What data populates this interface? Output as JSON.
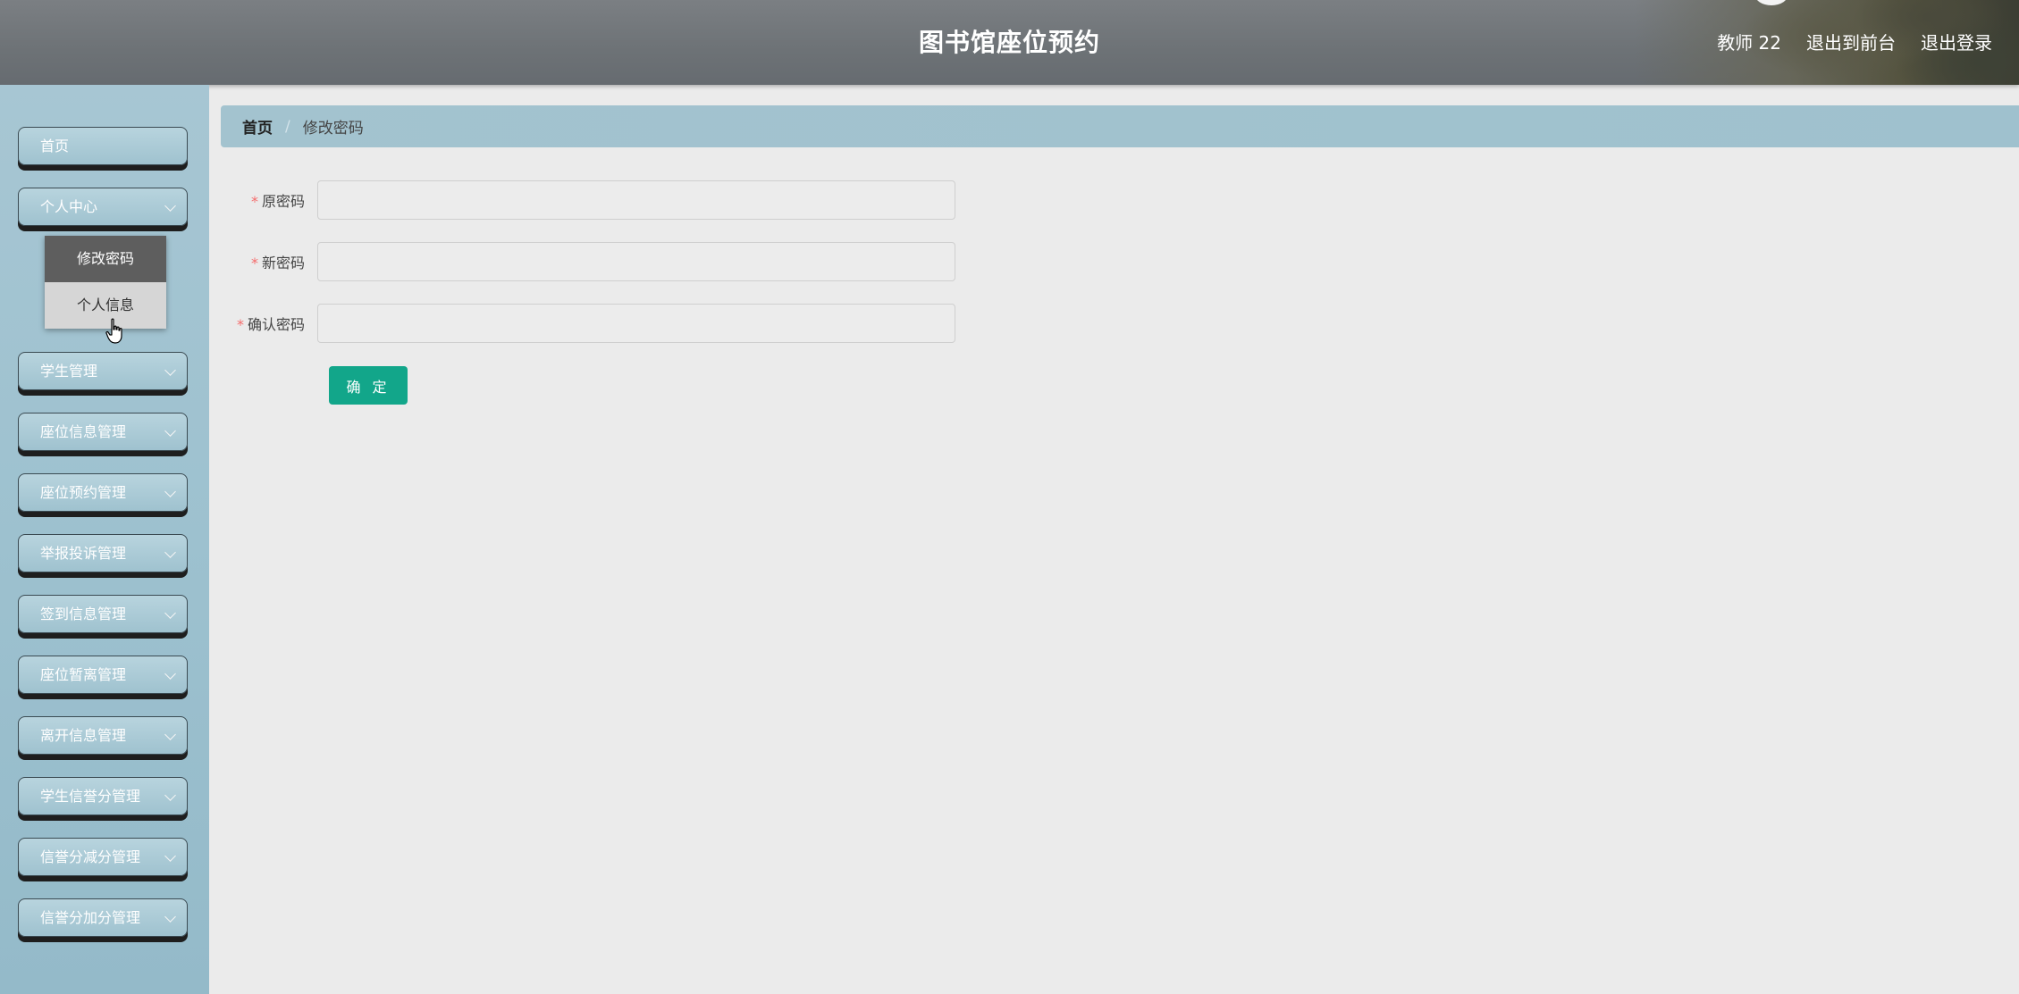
{
  "header": {
    "title": "图书馆座位预约",
    "user": "教师 22",
    "to_front": "退出到前台",
    "logout": "退出登录"
  },
  "sidebar": {
    "items": [
      {
        "label": "首页"
      },
      {
        "label": "个人中心"
      },
      {
        "label": "学生管理"
      },
      {
        "label": "座位信息管理"
      },
      {
        "label": "座位预约管理"
      },
      {
        "label": "举报投诉管理"
      },
      {
        "label": "签到信息管理"
      },
      {
        "label": "座位暂离管理"
      },
      {
        "label": "离开信息管理"
      },
      {
        "label": "学生信誉分管理"
      },
      {
        "label": "信誉分减分管理"
      },
      {
        "label": "信誉分加分管理"
      }
    ],
    "submenu": {
      "items": [
        {
          "label": "修改密码"
        },
        {
          "label": "个人信息"
        }
      ]
    }
  },
  "breadcrumb": {
    "home": "首页",
    "separator": "/",
    "current": "修改密码"
  },
  "form": {
    "required_mark": "*",
    "old_password": {
      "label": "原密码",
      "value": ""
    },
    "new_password": {
      "label": "新密码",
      "value": ""
    },
    "confirm_password": {
      "label": "确认密码",
      "value": ""
    },
    "submit_label": "确 定"
  },
  "colors": {
    "accent": "#12a68a",
    "sidebar": "#9fc2cf",
    "header": "#6d7276",
    "required": "#f56c6c"
  }
}
